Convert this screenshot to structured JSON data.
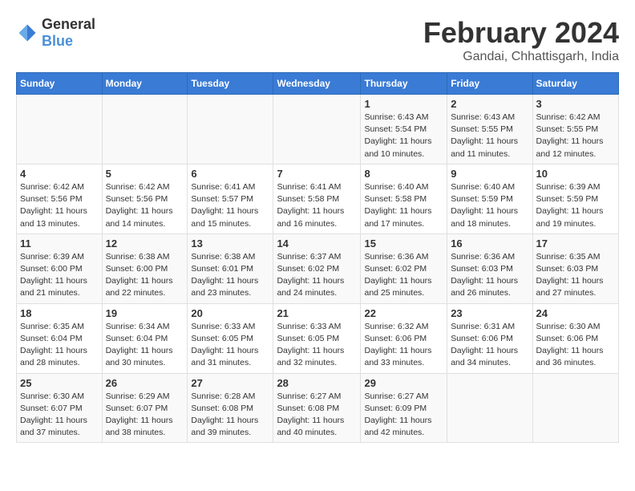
{
  "header": {
    "logo_general": "General",
    "logo_blue": "Blue",
    "month_year": "February 2024",
    "location": "Gandai, Chhattisgarh, India"
  },
  "days_of_week": [
    "Sunday",
    "Monday",
    "Tuesday",
    "Wednesday",
    "Thursday",
    "Friday",
    "Saturday"
  ],
  "weeks": [
    [
      {
        "day": "",
        "details": ""
      },
      {
        "day": "",
        "details": ""
      },
      {
        "day": "",
        "details": ""
      },
      {
        "day": "",
        "details": ""
      },
      {
        "day": "1",
        "details": "Sunrise: 6:43 AM\nSunset: 5:54 PM\nDaylight: 11 hours\nand 10 minutes."
      },
      {
        "day": "2",
        "details": "Sunrise: 6:43 AM\nSunset: 5:55 PM\nDaylight: 11 hours\nand 11 minutes."
      },
      {
        "day": "3",
        "details": "Sunrise: 6:42 AM\nSunset: 5:55 PM\nDaylight: 11 hours\nand 12 minutes."
      }
    ],
    [
      {
        "day": "4",
        "details": "Sunrise: 6:42 AM\nSunset: 5:56 PM\nDaylight: 11 hours\nand 13 minutes."
      },
      {
        "day": "5",
        "details": "Sunrise: 6:42 AM\nSunset: 5:56 PM\nDaylight: 11 hours\nand 14 minutes."
      },
      {
        "day": "6",
        "details": "Sunrise: 6:41 AM\nSunset: 5:57 PM\nDaylight: 11 hours\nand 15 minutes."
      },
      {
        "day": "7",
        "details": "Sunrise: 6:41 AM\nSunset: 5:58 PM\nDaylight: 11 hours\nand 16 minutes."
      },
      {
        "day": "8",
        "details": "Sunrise: 6:40 AM\nSunset: 5:58 PM\nDaylight: 11 hours\nand 17 minutes."
      },
      {
        "day": "9",
        "details": "Sunrise: 6:40 AM\nSunset: 5:59 PM\nDaylight: 11 hours\nand 18 minutes."
      },
      {
        "day": "10",
        "details": "Sunrise: 6:39 AM\nSunset: 5:59 PM\nDaylight: 11 hours\nand 19 minutes."
      }
    ],
    [
      {
        "day": "11",
        "details": "Sunrise: 6:39 AM\nSunset: 6:00 PM\nDaylight: 11 hours\nand 21 minutes."
      },
      {
        "day": "12",
        "details": "Sunrise: 6:38 AM\nSunset: 6:00 PM\nDaylight: 11 hours\nand 22 minutes."
      },
      {
        "day": "13",
        "details": "Sunrise: 6:38 AM\nSunset: 6:01 PM\nDaylight: 11 hours\nand 23 minutes."
      },
      {
        "day": "14",
        "details": "Sunrise: 6:37 AM\nSunset: 6:02 PM\nDaylight: 11 hours\nand 24 minutes."
      },
      {
        "day": "15",
        "details": "Sunrise: 6:36 AM\nSunset: 6:02 PM\nDaylight: 11 hours\nand 25 minutes."
      },
      {
        "day": "16",
        "details": "Sunrise: 6:36 AM\nSunset: 6:03 PM\nDaylight: 11 hours\nand 26 minutes."
      },
      {
        "day": "17",
        "details": "Sunrise: 6:35 AM\nSunset: 6:03 PM\nDaylight: 11 hours\nand 27 minutes."
      }
    ],
    [
      {
        "day": "18",
        "details": "Sunrise: 6:35 AM\nSunset: 6:04 PM\nDaylight: 11 hours\nand 28 minutes."
      },
      {
        "day": "19",
        "details": "Sunrise: 6:34 AM\nSunset: 6:04 PM\nDaylight: 11 hours\nand 30 minutes."
      },
      {
        "day": "20",
        "details": "Sunrise: 6:33 AM\nSunset: 6:05 PM\nDaylight: 11 hours\nand 31 minutes."
      },
      {
        "day": "21",
        "details": "Sunrise: 6:33 AM\nSunset: 6:05 PM\nDaylight: 11 hours\nand 32 minutes."
      },
      {
        "day": "22",
        "details": "Sunrise: 6:32 AM\nSunset: 6:06 PM\nDaylight: 11 hours\nand 33 minutes."
      },
      {
        "day": "23",
        "details": "Sunrise: 6:31 AM\nSunset: 6:06 PM\nDaylight: 11 hours\nand 34 minutes."
      },
      {
        "day": "24",
        "details": "Sunrise: 6:30 AM\nSunset: 6:06 PM\nDaylight: 11 hours\nand 36 minutes."
      }
    ],
    [
      {
        "day": "25",
        "details": "Sunrise: 6:30 AM\nSunset: 6:07 PM\nDaylight: 11 hours\nand 37 minutes."
      },
      {
        "day": "26",
        "details": "Sunrise: 6:29 AM\nSunset: 6:07 PM\nDaylight: 11 hours\nand 38 minutes."
      },
      {
        "day": "27",
        "details": "Sunrise: 6:28 AM\nSunset: 6:08 PM\nDaylight: 11 hours\nand 39 minutes."
      },
      {
        "day": "28",
        "details": "Sunrise: 6:27 AM\nSunset: 6:08 PM\nDaylight: 11 hours\nand 40 minutes."
      },
      {
        "day": "29",
        "details": "Sunrise: 6:27 AM\nSunset: 6:09 PM\nDaylight: 11 hours\nand 42 minutes."
      },
      {
        "day": "",
        "details": ""
      },
      {
        "day": "",
        "details": ""
      }
    ]
  ]
}
